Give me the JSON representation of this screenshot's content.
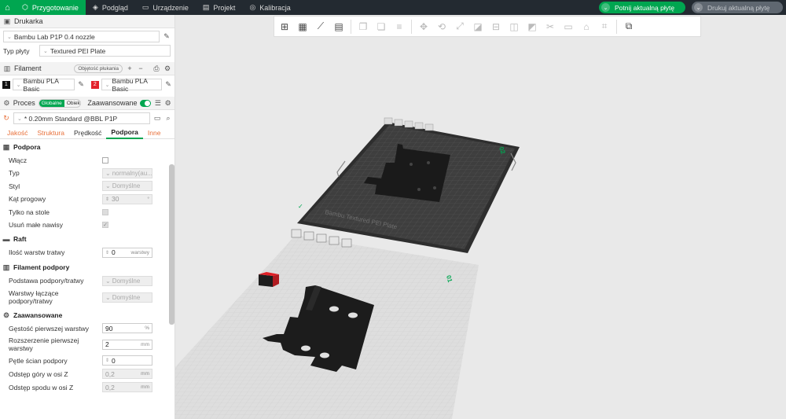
{
  "topbar": {
    "tabs": [
      {
        "label": "Przygotowanie",
        "icon": "cube-icon",
        "active": true
      },
      {
        "label": "Podgląd",
        "icon": "layers-icon",
        "active": false
      },
      {
        "label": "Urządzenie",
        "icon": "monitor-icon",
        "active": false
      },
      {
        "label": "Projekt",
        "icon": "document-icon",
        "active": false
      },
      {
        "label": "Kalibracja",
        "icon": "target-icon",
        "active": false
      }
    ],
    "slice_label": "Potnij aktualną płytę",
    "print_label": "Drukuj aktualną płytę"
  },
  "printer": {
    "section_title": "Drukarka",
    "model": "Bambu Lab P1P 0.4 nozzle",
    "plate_type_label": "Typ płyty",
    "plate_type": "Textured PEI Plate"
  },
  "filament": {
    "section_title": "Filament",
    "flush_label": "Objętość płukania",
    "slots": [
      {
        "index": "1",
        "name": "Bambu PLA Basic",
        "color": "#111111"
      },
      {
        "index": "2",
        "name": "Bambu PLA Basic",
        "color": "#e3222b"
      }
    ]
  },
  "process": {
    "section_title": "Proces",
    "global_label": "Globalne",
    "objects_label": "Obiekty",
    "advanced_label": "Zaawansowane",
    "preset": "* 0.20mm Standard @BBL P1P",
    "tabs": [
      "Jakość",
      "Struktura",
      "Prędkość",
      "Podpora",
      "Inne"
    ],
    "active_tab": "Podpora"
  },
  "support": {
    "title": "Podpora",
    "enable_label": "Włącz",
    "type_label": "Typ",
    "type_value": "normalny(au...",
    "style_label": "Styl",
    "style_value": "Domyślne",
    "threshold_label": "Kąt progowy",
    "threshold_value": "30",
    "on_plate_label": "Tylko na stole",
    "remove_small_label": "Usuń małe nawisy"
  },
  "raft": {
    "title": "Raft",
    "layers_label": "Ilość warstw tratwy",
    "layers_value": "0",
    "layers_unit": "warstwy"
  },
  "support_filament": {
    "title": "Filament podpory",
    "base_label": "Podstawa podpory/tratwy",
    "base_value": "Domyślne",
    "interface_label": "Warstwy łączące podpory/tratwy",
    "interface_value": "Domyślne"
  },
  "advanced": {
    "title": "Zaawansowane",
    "first_density_label": "Gęstość pierwszej warstwy",
    "first_density_value": "90",
    "first_density_unit": "%",
    "first_expansion_label": "Rozszerzenie pierwszej warstwy",
    "first_expansion_value": "2",
    "first_expansion_unit": "mm",
    "wall_loops_label": "Pętle ścian podpory",
    "wall_loops_value": "0",
    "top_z_label": "Odstęp góry w osi Z",
    "top_z_value": "0,2",
    "top_z_unit": "mm",
    "bottom_z_label": "Odstęp spodu w osi Z",
    "bottom_z_value": "0,2",
    "bottom_z_unit": "mm"
  },
  "viewport": {
    "plate1_label": "Bambu Textured PEI Plate",
    "plate1_number": "02",
    "plate2_number": "01"
  }
}
